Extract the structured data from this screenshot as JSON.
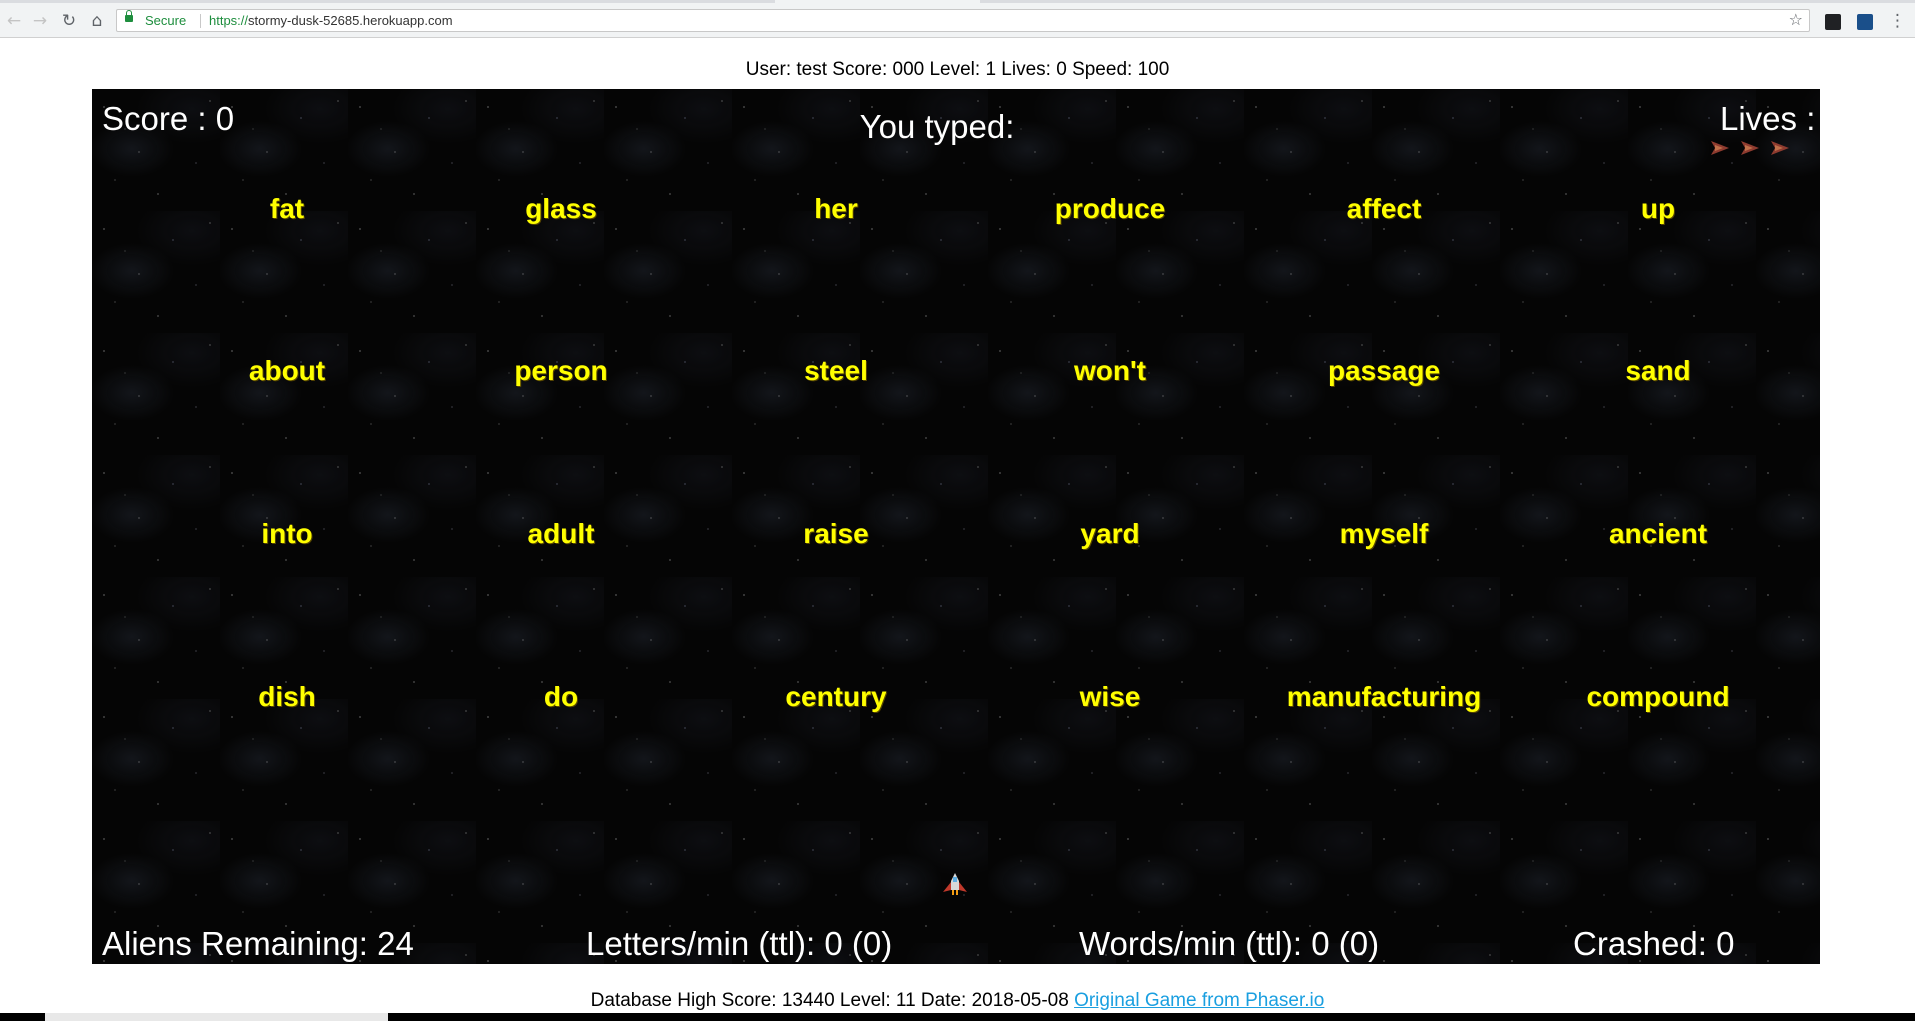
{
  "browser": {
    "secure_label": "Secure",
    "url_scheme": "https://",
    "url_host": "stormy-dusk-52685.herokuapp.com"
  },
  "status_line": "User: test Score: 000 Level: 1 Lives: 0 Speed: 100",
  "hud": {
    "score": "Score : 0",
    "typed": "You typed:",
    "lives": "Lives :",
    "lives_remaining": 3,
    "aliens_remaining": "Aliens Remaining: 24",
    "letters_per_min": "Letters/min (ttl): 0 (0)",
    "words_per_min": "Words/min (ttl): 0 (0)",
    "crashed": "Crashed: 0"
  },
  "aliens": [
    [
      "fat",
      "glass",
      "her",
      "produce",
      "affect",
      "up"
    ],
    [
      "about",
      "person",
      "steel",
      "won't",
      "passage",
      "sand"
    ],
    [
      "into",
      "adult",
      "raise",
      "yard",
      "myself",
      "ancient"
    ],
    [
      "dish",
      "do",
      "century",
      "wise",
      "manufacturing",
      "compound"
    ]
  ],
  "footer": {
    "text": "Database High Score: 13440 Level: 11 Date: 2018-05-08",
    "link": "Original Game from Phaser.io"
  },
  "colors": {
    "word": "#ffff00",
    "hud_text": "#ffffff",
    "link": "#1a9fe0",
    "secure": "#1e8e3e"
  }
}
